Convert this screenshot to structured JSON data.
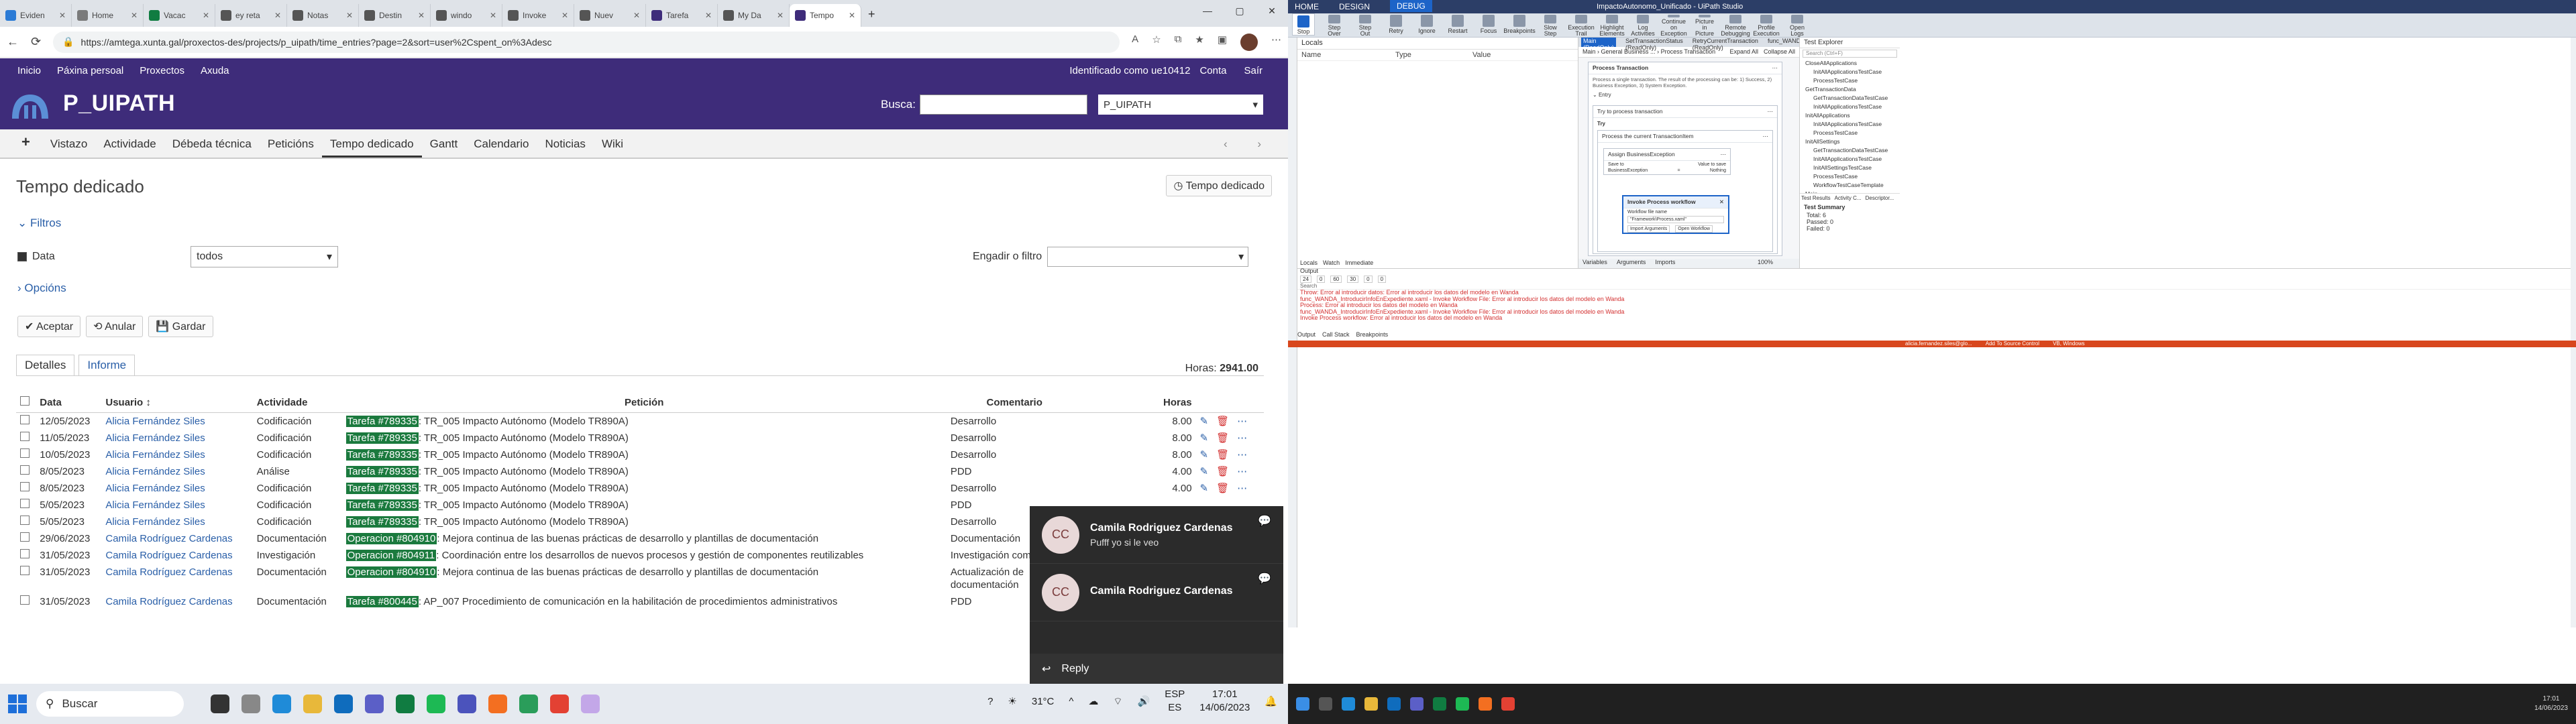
{
  "browser": {
    "tabs": [
      {
        "label": "Eviden",
        "color": "#2b7bd6"
      },
      {
        "label": "Home",
        "color": "#7a7a7a"
      },
      {
        "label": "Vacac",
        "color": "#107c41"
      },
      {
        "label": "ey reta",
        "color": "#555"
      },
      {
        "label": "Notas",
        "color": "#555"
      },
      {
        "label": "Destin",
        "color": "#555"
      },
      {
        "label": "windo",
        "color": "#555"
      },
      {
        "label": "Invoke",
        "color": "#555"
      },
      {
        "label": "Nuev",
        "color": "#555"
      },
      {
        "label": "Tarefa",
        "color": "#3e2c7a"
      },
      {
        "label": "My Da",
        "color": "#555"
      },
      {
        "label": "Tempo",
        "color": "#3e2c7a"
      }
    ],
    "url": "https://amtega.xunta.gal/proxectos-des/projects/p_uipath/time_entries?page=2&sort=user%2Cspent_on%3Adesc"
  },
  "topmenu": {
    "items": [
      "Inicio",
      "Páxina persoal",
      "Proxectos",
      "Axuda"
    ],
    "identified": "Identificado como ue10412",
    "account": "Conta",
    "logout": "Saír"
  },
  "header": {
    "project": "P_UIPATH",
    "search_label": "Busca:",
    "project_select": "P_UIPATH"
  },
  "mainmenu": [
    "Vistazo",
    "Actividade",
    "Débeda técnica",
    "Peticións",
    "Tempo dedicado",
    "Gantt",
    "Calendario",
    "Noticias",
    "Wiki"
  ],
  "page": {
    "title": "Tempo dedicado",
    "title_button": "Tempo dedicado",
    "filters": "Filtros",
    "date_label": "Data",
    "date_value": "todos",
    "add_filter": "Engadir o filtro",
    "options": "Opcións",
    "accept": "Aceptar",
    "cancel": "Anular",
    "save": "Gardar",
    "tab_details": "Detalles",
    "tab_report": "Informe",
    "hours_label": "Horas:",
    "hours_total": "2941.00"
  },
  "table": {
    "headers": [
      "Data",
      "Usuario",
      "Actividade",
      "Petición",
      "Comentario",
      "Horas"
    ],
    "rows": [
      {
        "date": "12/05/2023",
        "user": "Alicia Fernández Siles",
        "activity": "Codificación",
        "badge": "Tarefa #789335",
        "petition": ": TR_005 Impacto Autónomo (Modelo TR890A)",
        "comment": "Desarrollo",
        "hours": "8.00"
      },
      {
        "date": "11/05/2023",
        "user": "Alicia Fernández Siles",
        "activity": "Codificación",
        "badge": "Tarefa #789335",
        "petition": ": TR_005 Impacto Autónomo (Modelo TR890A)",
        "comment": "Desarrollo",
        "hours": "8.00"
      },
      {
        "date": "10/05/2023",
        "user": "Alicia Fernández Siles",
        "activity": "Codificación",
        "badge": "Tarefa #789335",
        "petition": ": TR_005 Impacto Autónomo (Modelo TR890A)",
        "comment": "Desarrollo",
        "hours": "8.00"
      },
      {
        "date": "8/05/2023",
        "user": "Alicia Fernández Siles",
        "activity": "Análise",
        "badge": "Tarefa #789335",
        "petition": ": TR_005 Impacto Autónomo (Modelo TR890A)",
        "comment": "PDD",
        "hours": "4.00"
      },
      {
        "date": "8/05/2023",
        "user": "Alicia Fernández Siles",
        "activity": "Codificación",
        "badge": "Tarefa #789335",
        "petition": ": TR_005 Impacto Autónomo (Modelo TR890A)",
        "comment": "Desarrollo",
        "hours": "4.00"
      },
      {
        "date": "5/05/2023",
        "user": "Alicia Fernández Siles",
        "activity": "Codificación",
        "badge": "Tarefa #789335",
        "petition": ": TR_005 Impacto Autónomo (Modelo TR890A)",
        "comment": "PDD",
        "hours": ""
      },
      {
        "date": "5/05/2023",
        "user": "Alicia Fernández Siles",
        "activity": "Codificación",
        "badge": "Tarefa #789335",
        "petition": ": TR_005 Impacto Autónomo (Modelo TR890A)",
        "comment": "Desarrollo",
        "hours": ""
      },
      {
        "date": "29/06/2023",
        "user": "Camila Rodríguez Cardenas",
        "activity": "Documentación",
        "badge": "Operacion #804910",
        "petition": ": Mejora continua de las buenas prácticas de desarrollo y plantillas de documentación",
        "comment": "Documentación",
        "hours": ""
      },
      {
        "date": "31/05/2023",
        "user": "Camila Rodríguez Cardenas",
        "activity": "Investigación",
        "badge": "Operacion #804911",
        "petition": ": Coordinación entre los desarrollos de nuevos procesos y gestión de componentes reutilizables",
        "comment": "Investigación componente",
        "hours": ""
      },
      {
        "date": "31/05/2023",
        "user": "Camila Rodríguez Cardenas",
        "activity": "Documentación",
        "badge": "Operacion #804910",
        "petition": ": Mejora continua de las buenas prácticas de desarrollo y plantillas de documentación",
        "comment": "Actualización de documentación",
        "hours": ""
      },
      {
        "date": "31/05/2023",
        "user": "Camila Rodríguez Cardenas",
        "activity": "Documentación",
        "badge": "Tarefa #800445",
        "petition": ": AP_007 Procedimiento de comunicación en la habilitación de procedimientos administrativos",
        "comment": "PDD",
        "hours": ""
      }
    ]
  },
  "chat": {
    "messages": [
      {
        "initials": "CC",
        "name": "Camila Rodriguez Cardenas",
        "text": "Pufff yo si le veo"
      },
      {
        "initials": "CC",
        "name": "Camila Rodriguez Cardenas",
        "text": ""
      }
    ],
    "reply": "Reply"
  },
  "taskbar": {
    "search": "Buscar",
    "temp": "31°C",
    "lang1": "ESP",
    "lang2": "ES",
    "time": "17:01",
    "date": "14/06/2023"
  },
  "studio": {
    "title": "ImpactoAutonomo_Unificado - UiPath Studio",
    "menu": [
      "HOME",
      "DESIGN",
      "DEBUG"
    ],
    "ribbon": [
      "Break",
      "Stop",
      "Step Into",
      "Step Over",
      "Step Out",
      "Retry",
      "Ignore",
      "Restart",
      "Focus",
      "Breakpoints",
      "Slow Step",
      "Execution Trail",
      "Highlight Elements",
      "Log Activities",
      "Continue on Exception",
      "Picture in Picture",
      "Remote Debugging",
      "Profile Execution",
      "Open Logs"
    ],
    "locals_title": "Locals",
    "locals_cols": [
      "Name",
      "Type",
      "Value"
    ],
    "design_tabs": [
      "Main (ReadOnly)",
      "SetTransactionStatus (ReadOnly)",
      "RetryCurrentTransaction (ReadOnly)",
      "func_WANDA_I"
    ],
    "crumb": [
      "Main",
      "General Business ...",
      "Process Transaction"
    ],
    "expand_all": "Expand All",
    "collapse_all": "Collapse All",
    "seq_title": "Process Transaction",
    "seq_desc": "Process a single transaction. The result of the processing can be: 1) Success, 2) Business Exception, 3) System Exception.",
    "entry": "Entry",
    "try_title": "Try to process transaction",
    "try_label": "Try",
    "process_item": "Process the current TransactionItem",
    "assign_title": "Assign BusinessException",
    "assign_to": "Save to",
    "assign_value": "Value to save",
    "assign_left": "BusinessException",
    "assign_right": "Nothing",
    "invoke_title": "Invoke Process workflow",
    "invoke_file_label": "Workflow file name",
    "invoke_file": "\"Framework\\Process.xaml\"",
    "import_args": "Import Arguments",
    "open_workflow": "Open Workflow",
    "bottom_tabs": [
      "Variables",
      "Arguments",
      "Imports"
    ],
    "zoom": "100%",
    "explorer_title": "Test Explorer",
    "explorer_search": "Search (Ctrl+F)",
    "explorer_items": [
      "CloseAllApplications",
      "InitAllApplicationsTestCase",
      "ProcessTestCase",
      "GetTransactionData",
      "GetTransactionDataTestCase",
      "InitAllApplicationsTestCase",
      "InitAllApplications",
      "InitAllApplicationsTestCase",
      "ProcessTestCase",
      "InitAllSettings",
      "GetTransactionDataTestCase",
      "InitAllApplicationsTestCase",
      "InitAllSettingsTestCase",
      "ProcessTestCase",
      "WorkflowTestCaseTemplate",
      "Main",
      "MainTestCase",
      "Process"
    ],
    "explorer_tabs": [
      "Test Results",
      "Activity C...",
      "Descriptor..."
    ],
    "test_summary": "Test Summary",
    "summary": [
      "Total: 6",
      "Passed: 0",
      "Failed: 0"
    ],
    "panel_tabs": [
      "Locals",
      "Watch",
      "Immediate"
    ],
    "output_title": "Output",
    "output_counts": [
      "24",
      "0",
      "60",
      "30",
      "0",
      "0"
    ],
    "output_search": "Search",
    "errors": [
      "Throw: Error al introducir datos: Error al introducir los datos del modelo en Wanda",
      "func_WANDA_IntroducirInfoEnExpediente.xaml - Invoke Workflow File: Error al introducir los datos del modelo en Wanda",
      "Process: Error al introducir los datos del modelo en Wanda",
      "func_WANDA_IntroducirInfoEnExpediente.xaml - Invoke Workflow File: Error al introducir los datos del modelo en Wanda",
      "Invoke Process workflow: Error al introducir los datos del modelo en Wanda"
    ],
    "output_tabs": [
      "Output",
      "Call Stack",
      "Breakpoints"
    ],
    "status_user": "alicia.fernandez.siles@glo...",
    "status_source": "Add To Source Control",
    "status_orch": "VB, Windows",
    "task_time": "17:01",
    "task_date": "14/06/2023"
  }
}
